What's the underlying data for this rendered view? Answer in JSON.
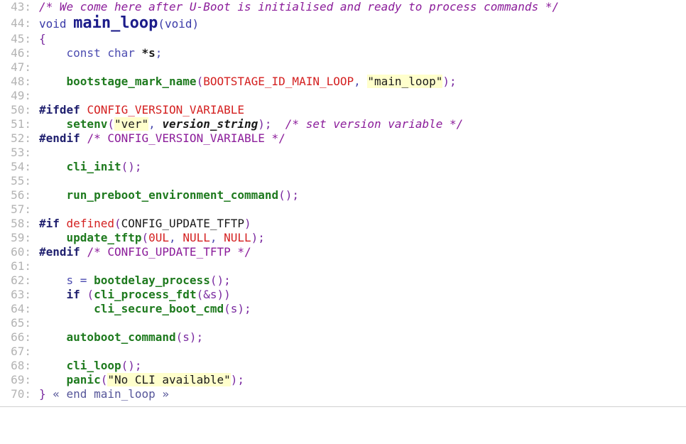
{
  "code": {
    "line_numbers": [
      "43",
      "44",
      "45",
      "46",
      "47",
      "48",
      "49",
      "50",
      "51",
      "52",
      "53",
      "54",
      "55",
      "56",
      "57",
      "58",
      "59",
      "60",
      "61",
      "62",
      "63",
      "64",
      "65",
      "66",
      "67",
      "68",
      "69",
      "70"
    ],
    "l43_comment": "/* We come here after U-Boot is initialised and ready to process commands */",
    "l44_void1": "void ",
    "l44_name": "main_loop",
    "l44_paren": "(void)",
    "l45_brace": "{",
    "l46_decl": "const char ",
    "l46_var": "*s",
    "l46_semi": ";",
    "l48_fn": "bootstage_mark_name",
    "l48_open": "(",
    "l48_macro": "BOOTSTAGE_ID_MAIN_LOOP",
    "l48_comma": ", ",
    "l48_str": "\"main_loop\"",
    "l48_close": ");",
    "l50_pp": "#ifdef",
    "l50_cfg": "CONFIG_VERSION_VARIABLE",
    "l51_fn": "setenv",
    "l51_open": "(",
    "l51_str": "\"ver\"",
    "l51_comma": ", ",
    "l51_var": "version_string",
    "l51_close": ");",
    "l51_comment": "/* set version variable */",
    "l52_pp": "#endif",
    "l52_comment": "/* CONFIG_VERSION_VARIABLE */",
    "l54_fn": "cli_init",
    "l54_call": "();",
    "l56_fn": "run_preboot_environment_command",
    "l56_call": "();",
    "l58_pp": "#if",
    "l58_def": "defined",
    "l58_open": "(",
    "l58_cfg": "CONFIG_UPDATE_TFTP",
    "l58_close": ")",
    "l59_fn": "update_tftp",
    "l59_open": "(",
    "l59_num": "0UL",
    "l59_sep1": ", ",
    "l59_null1": "NULL",
    "l59_sep2": ", ",
    "l59_null2": "NULL",
    "l59_close": ");",
    "l60_pp": "#endif",
    "l60_comment": "/* CONFIG_UPDATE_TFTP */",
    "l62_lhs": "s = ",
    "l62_fn": "bootdelay_process",
    "l62_call": "();",
    "l63_if": "if ",
    "l63_open": "(",
    "l63_fn": "cli_process_fdt",
    "l63_args": "(&s))",
    "l64_fn": "cli_secure_boot_cmd",
    "l64_args": "(s);",
    "l66_fn": "autoboot_command",
    "l66_args": "(s);",
    "l68_fn": "cli_loop",
    "l68_call": "();",
    "l69_fn": "panic",
    "l69_open": "(",
    "l69_str": "\"No CLI available\"",
    "l69_close": ");",
    "l70_brace": "}",
    "l70_fold": " « end main_loop »"
  }
}
